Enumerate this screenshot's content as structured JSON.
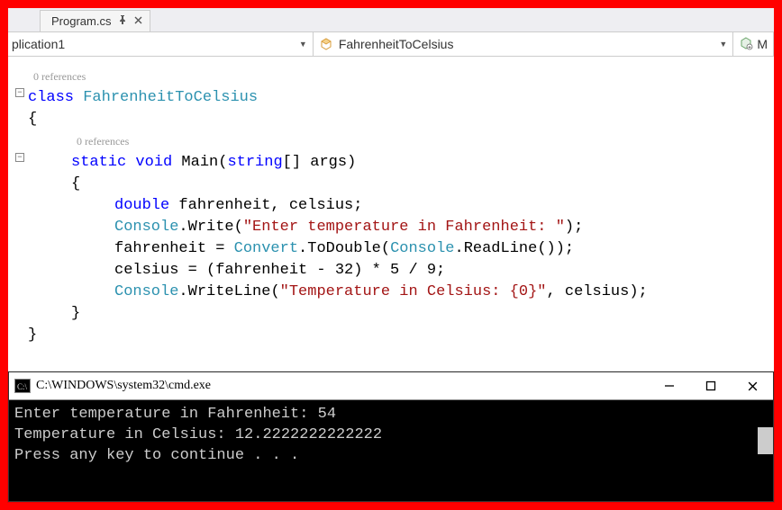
{
  "tab": {
    "name": "Program.cs"
  },
  "nav": {
    "scope": "plication1",
    "member": "FahrenheitToCelsius",
    "third": "M"
  },
  "codelens": {
    "class": "0 references",
    "method": "0 references"
  },
  "code": {
    "class_kw": "class",
    "class_name": "FahrenheitToCelsius",
    "obrace": "{",
    "cbrace": "}",
    "method_sig_static": "static",
    "method_sig_void": "void",
    "method_name_plain": " Main(",
    "method_param_type": "string",
    "method_tail": "[] args)",
    "decl_double": "double",
    "decl_vars": " fahrenheit, celsius;",
    "console": "Console",
    "write_call": ".Write(",
    "str_prompt": "\"Enter temperature in Fahrenheit: \"",
    "close_paren_semi": ");",
    "assign_prefix": "fahrenheit = ",
    "convert": "Convert",
    "todouble": ".ToDouble(",
    "readline": ".ReadLine());",
    "calc": "celsius = (fahrenheit - 32) * 5 / 9;",
    "writeline_call": ".WriteLine(",
    "str_result": "\"Temperature in Celsius: {0}\"",
    "writeline_tail": ", celsius);"
  },
  "console": {
    "title": "C:\\WINDOWS\\system32\\cmd.exe",
    "line1": "Enter temperature in Fahrenheit: 54",
    "line2": "Temperature in Celsius: 12.2222222222222",
    "line3": "Press any key to continue . . ."
  }
}
